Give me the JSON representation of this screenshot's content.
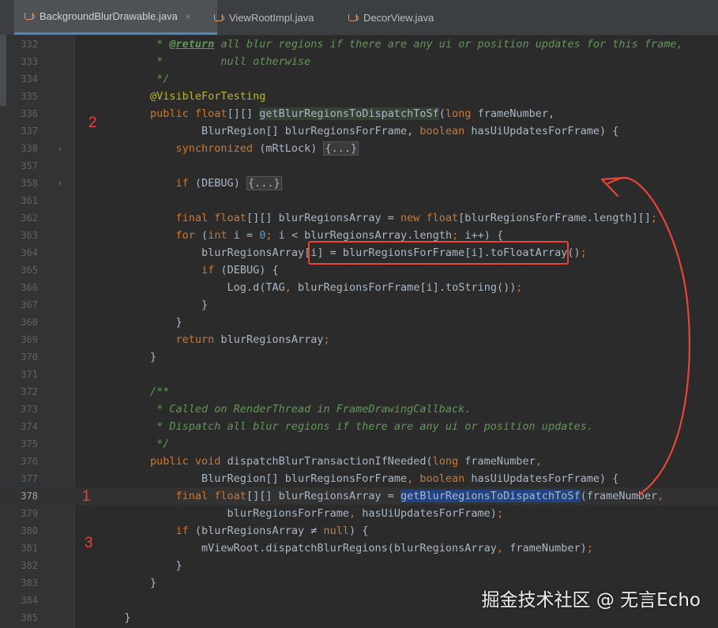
{
  "tabs": [
    {
      "label": "BackgroundBlurDrawable.java",
      "active": true,
      "close": "×"
    },
    {
      "label": "ViewRootImpl.java",
      "active": false
    },
    {
      "label": "DecorView.java",
      "active": false
    }
  ],
  "fold_marker": "›",
  "lines": [
    {
      "n": "332",
      "segs": [
        [
          "cm",
          "         * "
        ],
        [
          "doctag",
          "@return"
        ],
        [
          "cm",
          " all blur regions if there are any ui or position updates for this frame,"
        ]
      ]
    },
    {
      "n": "333",
      "segs": [
        [
          "cm",
          "         *         null otherwise"
        ]
      ]
    },
    {
      "n": "334",
      "segs": [
        [
          "cm",
          "         */"
        ]
      ]
    },
    {
      "n": "335",
      "segs": [
        [
          "an",
          "        @VisibleForTesting"
        ]
      ]
    },
    {
      "n": "336",
      "segs": [
        [
          "kw",
          "        public float"
        ],
        [
          "",
          "[][] "
        ],
        [
          "fnhl",
          "getBlurRegionsToDispatchToSf"
        ],
        [
          "",
          "("
        ],
        [
          "kw",
          "long "
        ],
        [
          "",
          "frameNumber,"
        ]
      ]
    },
    {
      "n": "337",
      "segs": [
        [
          "",
          "                BlurRegion[] blurRegionsForFrame, "
        ],
        [
          "kw",
          "boolean "
        ],
        [
          "",
          "hasUiUpdatesForFrame) {"
        ]
      ]
    },
    {
      "n": "338",
      "fold": true,
      "segs": [
        [
          "kw",
          "            synchronized "
        ],
        [
          "",
          "(mRtLock) "
        ],
        [
          "folded",
          "{...}"
        ]
      ]
    },
    {
      "n": "357",
      "segs": []
    },
    {
      "n": "358",
      "fold": true,
      "segs": [
        [
          "kw",
          "            if "
        ],
        [
          "",
          "(DEBUG) "
        ],
        [
          "folded",
          "{...}"
        ]
      ]
    },
    {
      "n": "361",
      "segs": []
    },
    {
      "n": "362",
      "segs": [
        [
          "kw",
          "            final float"
        ],
        [
          "",
          "[][] blurRegionsArray = "
        ],
        [
          "kw",
          "new float"
        ],
        [
          "",
          "[blurRegionsForFrame.length][]"
        ],
        [
          "kw",
          ";"
        ]
      ]
    },
    {
      "n": "363",
      "segs": [
        [
          "kw",
          "            for "
        ],
        [
          "",
          "("
        ],
        [
          "kw",
          "int "
        ],
        [
          "",
          "i = "
        ],
        [
          "num",
          "0"
        ],
        [
          "kw",
          "; "
        ],
        [
          "",
          "i < blurRegionsArray.length"
        ],
        [
          "kw",
          "; "
        ],
        [
          "",
          "i++) {"
        ]
      ]
    },
    {
      "n": "364",
      "segs": [
        [
          "",
          "                blurRegionsArray[i] = blurRegionsForFrame[i].toFloatArray()"
        ],
        [
          "kw",
          ";"
        ]
      ]
    },
    {
      "n": "365",
      "segs": [
        [
          "kw",
          "                if "
        ],
        [
          "",
          "(DEBUG) {"
        ]
      ]
    },
    {
      "n": "366",
      "segs": [
        [
          "",
          "                    Log."
        ],
        [
          "",
          "d"
        ],
        [
          "",
          "("
        ],
        [
          "",
          "TAG"
        ],
        [
          "kw",
          ", "
        ],
        [
          "",
          "blurRegionsForFrame[i].toString())"
        ],
        [
          "kw",
          ";"
        ]
      ]
    },
    {
      "n": "367",
      "segs": [
        [
          "",
          "                }"
        ]
      ]
    },
    {
      "n": "368",
      "segs": [
        [
          "",
          "            }"
        ]
      ]
    },
    {
      "n": "369",
      "segs": [
        [
          "kw",
          "            return "
        ],
        [
          "",
          "blurRegionsArray"
        ],
        [
          "kw",
          ";"
        ]
      ]
    },
    {
      "n": "370",
      "segs": [
        [
          "",
          "        }"
        ]
      ]
    },
    {
      "n": "371",
      "segs": []
    },
    {
      "n": "372",
      "segs": [
        [
          "cm",
          "        /**"
        ]
      ]
    },
    {
      "n": "373",
      "segs": [
        [
          "cm",
          "         * Called on RenderThread in FrameDrawingCallback."
        ]
      ]
    },
    {
      "n": "374",
      "segs": [
        [
          "cm",
          "         * Dispatch all blur regions if there are any ui or position updates."
        ]
      ]
    },
    {
      "n": "375",
      "segs": [
        [
          "cm",
          "         */"
        ]
      ]
    },
    {
      "n": "376",
      "segs": [
        [
          "kw",
          "        public void "
        ],
        [
          "",
          "dispatchBlurTransactionIfNeeded("
        ],
        [
          "kw",
          "long "
        ],
        [
          "",
          "frameNumber"
        ],
        [
          "kw",
          ","
        ]
      ]
    },
    {
      "n": "377",
      "segs": [
        [
          "",
          "                BlurRegion[] blurRegionsForFrame"
        ],
        [
          "kw",
          ", boolean "
        ],
        [
          "",
          "hasUiUpdatesForFrame) {"
        ]
      ]
    },
    {
      "n": "378",
      "current": true,
      "segs": [
        [
          "kw",
          "            final float"
        ],
        [
          "",
          "[][] blurRegionsArray = "
        ],
        [
          "sel",
          "getBlurRegionsToDispatchToSf"
        ],
        [
          "",
          "(frameNumber"
        ],
        [
          "kw",
          ","
        ]
      ]
    },
    {
      "n": "379",
      "segs": [
        [
          "",
          "                    blurRegionsForFrame"
        ],
        [
          "kw",
          ", "
        ],
        [
          "",
          "hasUiUpdatesForFrame)"
        ],
        [
          "kw",
          ";"
        ]
      ]
    },
    {
      "n": "380",
      "segs": [
        [
          "kw",
          "            if "
        ],
        [
          "",
          "(blurRegionsArray ≠ "
        ],
        [
          "kw",
          "null"
        ],
        [
          "",
          ") {"
        ]
      ]
    },
    {
      "n": "381",
      "segs": [
        [
          "",
          "                mViewRoot.dispatchBlurRegions(blurRegionsArray"
        ],
        [
          "kw",
          ", "
        ],
        [
          "",
          "frameNumber)"
        ],
        [
          "kw",
          ";"
        ]
      ]
    },
    {
      "n": "382",
      "segs": [
        [
          "",
          "            }"
        ]
      ]
    },
    {
      "n": "383",
      "segs": [
        [
          "",
          "        }"
        ]
      ]
    },
    {
      "n": "384",
      "segs": []
    },
    {
      "n": "385",
      "segs": [
        [
          "",
          "    }"
        ]
      ]
    }
  ],
  "annotations": {
    "label1": "1",
    "label2": "2",
    "label3": "3"
  },
  "watermark": "掘金技术社区 @ 无言Echo",
  "colors": {
    "annotation_red": "#e8443a",
    "selection": "#214283",
    "keyword": "#cc7832",
    "comment": "#629755"
  }
}
